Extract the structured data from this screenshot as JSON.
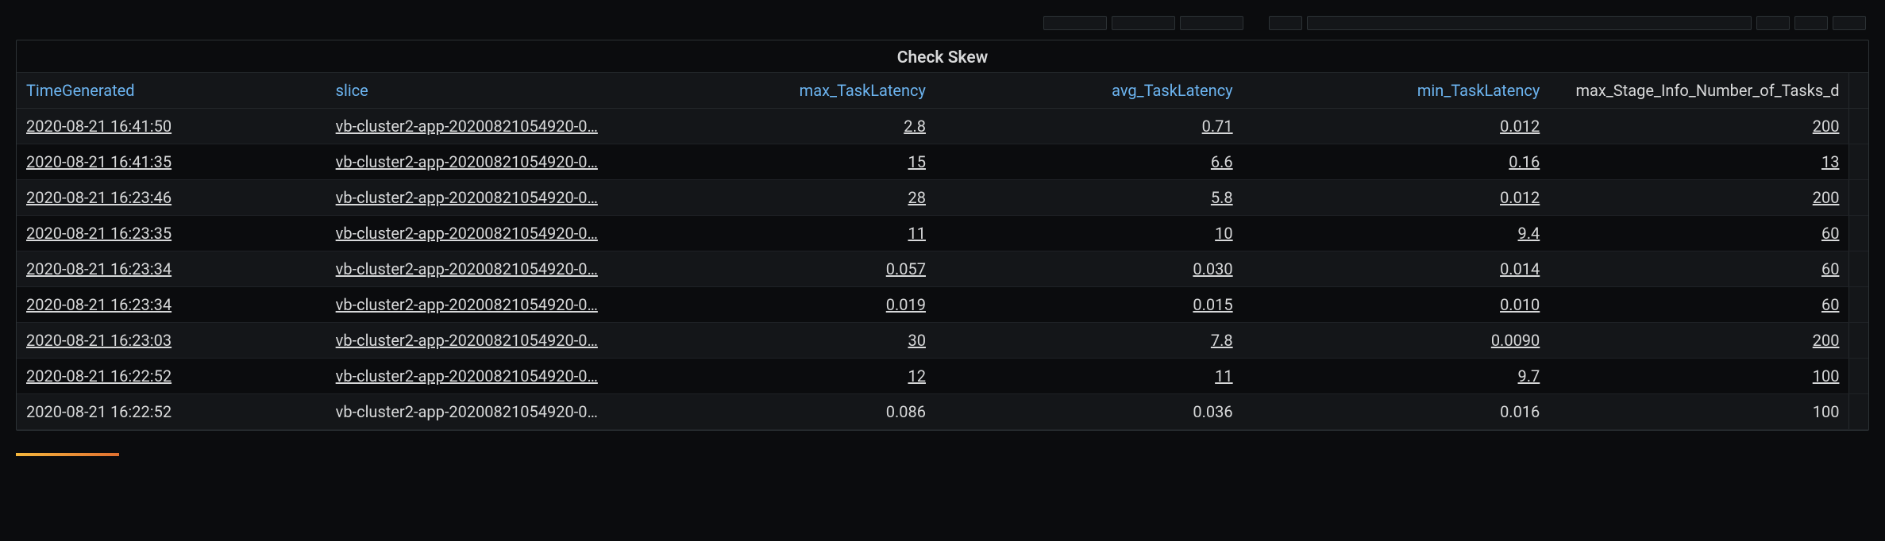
{
  "panel": {
    "title": "Check Skew"
  },
  "columns": {
    "c0": "TimeGenerated",
    "c1": "slice",
    "c2": "max_TaskLatency",
    "c3": "avg_TaskLatency",
    "c4": "min_TaskLatency",
    "c5": "max_Stage_Info_Number_of_Tasks_d"
  },
  "rows": [
    {
      "time": "2020-08-21 16:41:50",
      "slice": "vb-cluster2-app-20200821054920-0…",
      "max": "2.8",
      "avg": "0.71",
      "min": "0.012",
      "tasks": "200",
      "link": true
    },
    {
      "time": "2020-08-21 16:41:35",
      "slice": "vb-cluster2-app-20200821054920-0…",
      "max": "15",
      "avg": "6.6",
      "min": "0.16",
      "tasks": "13",
      "link": true
    },
    {
      "time": "2020-08-21 16:23:46",
      "slice": "vb-cluster2-app-20200821054920-0…",
      "max": "28",
      "avg": "5.8",
      "min": "0.012",
      "tasks": "200",
      "link": true
    },
    {
      "time": "2020-08-21 16:23:35",
      "slice": "vb-cluster2-app-20200821054920-0…",
      "max": "11",
      "avg": "10",
      "min": "9.4",
      "tasks": "60",
      "link": true
    },
    {
      "time": "2020-08-21 16:23:34",
      "slice": "vb-cluster2-app-20200821054920-0…",
      "max": "0.057",
      "avg": "0.030",
      "min": "0.014",
      "tasks": "60",
      "link": true
    },
    {
      "time": "2020-08-21 16:23:34",
      "slice": "vb-cluster2-app-20200821054920-0…",
      "max": "0.019",
      "avg": "0.015",
      "min": "0.010",
      "tasks": "60",
      "link": true
    },
    {
      "time": "2020-08-21 16:23:03",
      "slice": "vb-cluster2-app-20200821054920-0…",
      "max": "30",
      "avg": "7.8",
      "min": "0.0090",
      "tasks": "200",
      "link": true
    },
    {
      "time": "2020-08-21 16:22:52",
      "slice": "vb-cluster2-app-20200821054920-0…",
      "max": "12",
      "avg": "11",
      "min": "9.7",
      "tasks": "100",
      "link": true
    },
    {
      "time": "2020-08-21 16:22:52",
      "slice": "vb-cluster2-app-20200821054920-0…",
      "max": "0.086",
      "avg": "0.036",
      "min": "0.016",
      "tasks": "100",
      "link": false
    }
  ]
}
